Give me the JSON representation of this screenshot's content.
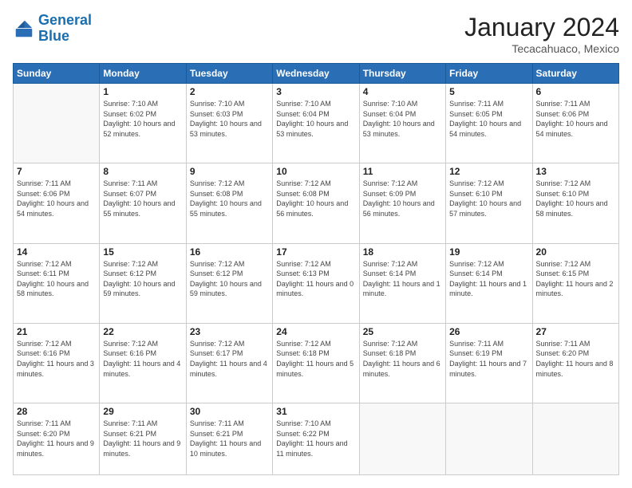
{
  "header": {
    "logo_line1": "General",
    "logo_line2": "Blue",
    "month_title": "January 2024",
    "location": "Tecacahuaco, Mexico"
  },
  "days_of_week": [
    "Sunday",
    "Monday",
    "Tuesday",
    "Wednesday",
    "Thursday",
    "Friday",
    "Saturday"
  ],
  "weeks": [
    [
      {
        "day": "",
        "sunrise": "",
        "sunset": "",
        "daylight": ""
      },
      {
        "day": "1",
        "sunrise": "Sunrise: 7:10 AM",
        "sunset": "Sunset: 6:02 PM",
        "daylight": "Daylight: 10 hours and 52 minutes."
      },
      {
        "day": "2",
        "sunrise": "Sunrise: 7:10 AM",
        "sunset": "Sunset: 6:03 PM",
        "daylight": "Daylight: 10 hours and 53 minutes."
      },
      {
        "day": "3",
        "sunrise": "Sunrise: 7:10 AM",
        "sunset": "Sunset: 6:04 PM",
        "daylight": "Daylight: 10 hours and 53 minutes."
      },
      {
        "day": "4",
        "sunrise": "Sunrise: 7:10 AM",
        "sunset": "Sunset: 6:04 PM",
        "daylight": "Daylight: 10 hours and 53 minutes."
      },
      {
        "day": "5",
        "sunrise": "Sunrise: 7:11 AM",
        "sunset": "Sunset: 6:05 PM",
        "daylight": "Daylight: 10 hours and 54 minutes."
      },
      {
        "day": "6",
        "sunrise": "Sunrise: 7:11 AM",
        "sunset": "Sunset: 6:06 PM",
        "daylight": "Daylight: 10 hours and 54 minutes."
      }
    ],
    [
      {
        "day": "7",
        "sunrise": "Sunrise: 7:11 AM",
        "sunset": "Sunset: 6:06 PM",
        "daylight": "Daylight: 10 hours and 54 minutes."
      },
      {
        "day": "8",
        "sunrise": "Sunrise: 7:11 AM",
        "sunset": "Sunset: 6:07 PM",
        "daylight": "Daylight: 10 hours and 55 minutes."
      },
      {
        "day": "9",
        "sunrise": "Sunrise: 7:12 AM",
        "sunset": "Sunset: 6:08 PM",
        "daylight": "Daylight: 10 hours and 55 minutes."
      },
      {
        "day": "10",
        "sunrise": "Sunrise: 7:12 AM",
        "sunset": "Sunset: 6:08 PM",
        "daylight": "Daylight: 10 hours and 56 minutes."
      },
      {
        "day": "11",
        "sunrise": "Sunrise: 7:12 AM",
        "sunset": "Sunset: 6:09 PM",
        "daylight": "Daylight: 10 hours and 56 minutes."
      },
      {
        "day": "12",
        "sunrise": "Sunrise: 7:12 AM",
        "sunset": "Sunset: 6:10 PM",
        "daylight": "Daylight: 10 hours and 57 minutes."
      },
      {
        "day": "13",
        "sunrise": "Sunrise: 7:12 AM",
        "sunset": "Sunset: 6:10 PM",
        "daylight": "Daylight: 10 hours and 58 minutes."
      }
    ],
    [
      {
        "day": "14",
        "sunrise": "Sunrise: 7:12 AM",
        "sunset": "Sunset: 6:11 PM",
        "daylight": "Daylight: 10 hours and 58 minutes."
      },
      {
        "day": "15",
        "sunrise": "Sunrise: 7:12 AM",
        "sunset": "Sunset: 6:12 PM",
        "daylight": "Daylight: 10 hours and 59 minutes."
      },
      {
        "day": "16",
        "sunrise": "Sunrise: 7:12 AM",
        "sunset": "Sunset: 6:12 PM",
        "daylight": "Daylight: 10 hours and 59 minutes."
      },
      {
        "day": "17",
        "sunrise": "Sunrise: 7:12 AM",
        "sunset": "Sunset: 6:13 PM",
        "daylight": "Daylight: 11 hours and 0 minutes."
      },
      {
        "day": "18",
        "sunrise": "Sunrise: 7:12 AM",
        "sunset": "Sunset: 6:14 PM",
        "daylight": "Daylight: 11 hours and 1 minute."
      },
      {
        "day": "19",
        "sunrise": "Sunrise: 7:12 AM",
        "sunset": "Sunset: 6:14 PM",
        "daylight": "Daylight: 11 hours and 1 minute."
      },
      {
        "day": "20",
        "sunrise": "Sunrise: 7:12 AM",
        "sunset": "Sunset: 6:15 PM",
        "daylight": "Daylight: 11 hours and 2 minutes."
      }
    ],
    [
      {
        "day": "21",
        "sunrise": "Sunrise: 7:12 AM",
        "sunset": "Sunset: 6:16 PM",
        "daylight": "Daylight: 11 hours and 3 minutes."
      },
      {
        "day": "22",
        "sunrise": "Sunrise: 7:12 AM",
        "sunset": "Sunset: 6:16 PM",
        "daylight": "Daylight: 11 hours and 4 minutes."
      },
      {
        "day": "23",
        "sunrise": "Sunrise: 7:12 AM",
        "sunset": "Sunset: 6:17 PM",
        "daylight": "Daylight: 11 hours and 4 minutes."
      },
      {
        "day": "24",
        "sunrise": "Sunrise: 7:12 AM",
        "sunset": "Sunset: 6:18 PM",
        "daylight": "Daylight: 11 hours and 5 minutes."
      },
      {
        "day": "25",
        "sunrise": "Sunrise: 7:12 AM",
        "sunset": "Sunset: 6:18 PM",
        "daylight": "Daylight: 11 hours and 6 minutes."
      },
      {
        "day": "26",
        "sunrise": "Sunrise: 7:11 AM",
        "sunset": "Sunset: 6:19 PM",
        "daylight": "Daylight: 11 hours and 7 minutes."
      },
      {
        "day": "27",
        "sunrise": "Sunrise: 7:11 AM",
        "sunset": "Sunset: 6:20 PM",
        "daylight": "Daylight: 11 hours and 8 minutes."
      }
    ],
    [
      {
        "day": "28",
        "sunrise": "Sunrise: 7:11 AM",
        "sunset": "Sunset: 6:20 PM",
        "daylight": "Daylight: 11 hours and 9 minutes."
      },
      {
        "day": "29",
        "sunrise": "Sunrise: 7:11 AM",
        "sunset": "Sunset: 6:21 PM",
        "daylight": "Daylight: 11 hours and 9 minutes."
      },
      {
        "day": "30",
        "sunrise": "Sunrise: 7:11 AM",
        "sunset": "Sunset: 6:21 PM",
        "daylight": "Daylight: 11 hours and 10 minutes."
      },
      {
        "day": "31",
        "sunrise": "Sunrise: 7:10 AM",
        "sunset": "Sunset: 6:22 PM",
        "daylight": "Daylight: 11 hours and 11 minutes."
      },
      {
        "day": "",
        "sunrise": "",
        "sunset": "",
        "daylight": ""
      },
      {
        "day": "",
        "sunrise": "",
        "sunset": "",
        "daylight": ""
      },
      {
        "day": "",
        "sunrise": "",
        "sunset": "",
        "daylight": ""
      }
    ]
  ]
}
